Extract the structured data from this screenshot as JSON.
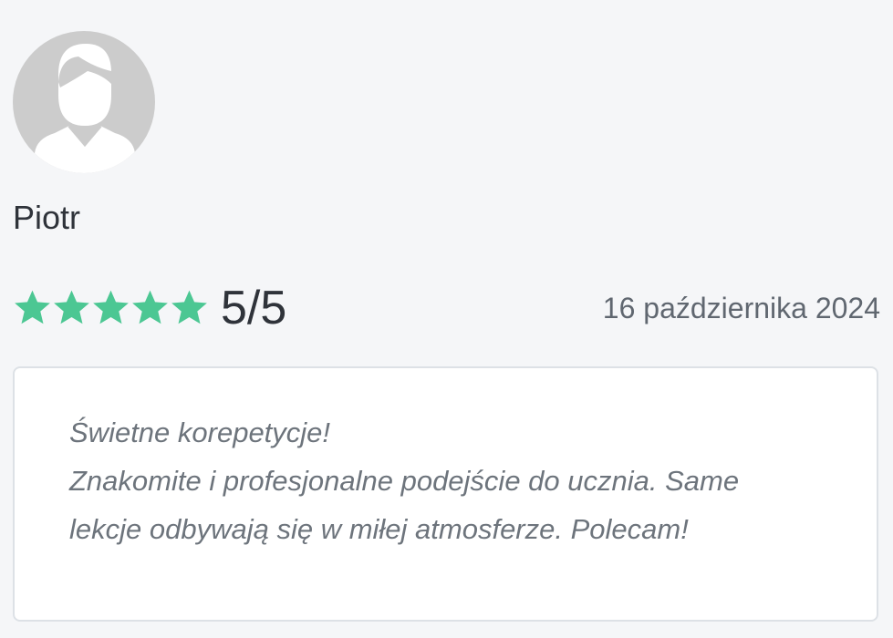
{
  "reviewer": {
    "avatar_icon": "user-silhouette-icon",
    "name": "Piotr"
  },
  "rating": {
    "stars_filled": 5,
    "stars_total": 5,
    "star_icon": "star-icon",
    "star_color": "#4cc793",
    "score_text": "5/5"
  },
  "date": "16 października 2024",
  "review": {
    "lines": [
      "Świetne korepetycje!",
      "Znakomite i profesjonalne podejście do ucznia. Same",
      "lekcje odbywają się w miłej atmosferze. Polecam!"
    ]
  }
}
